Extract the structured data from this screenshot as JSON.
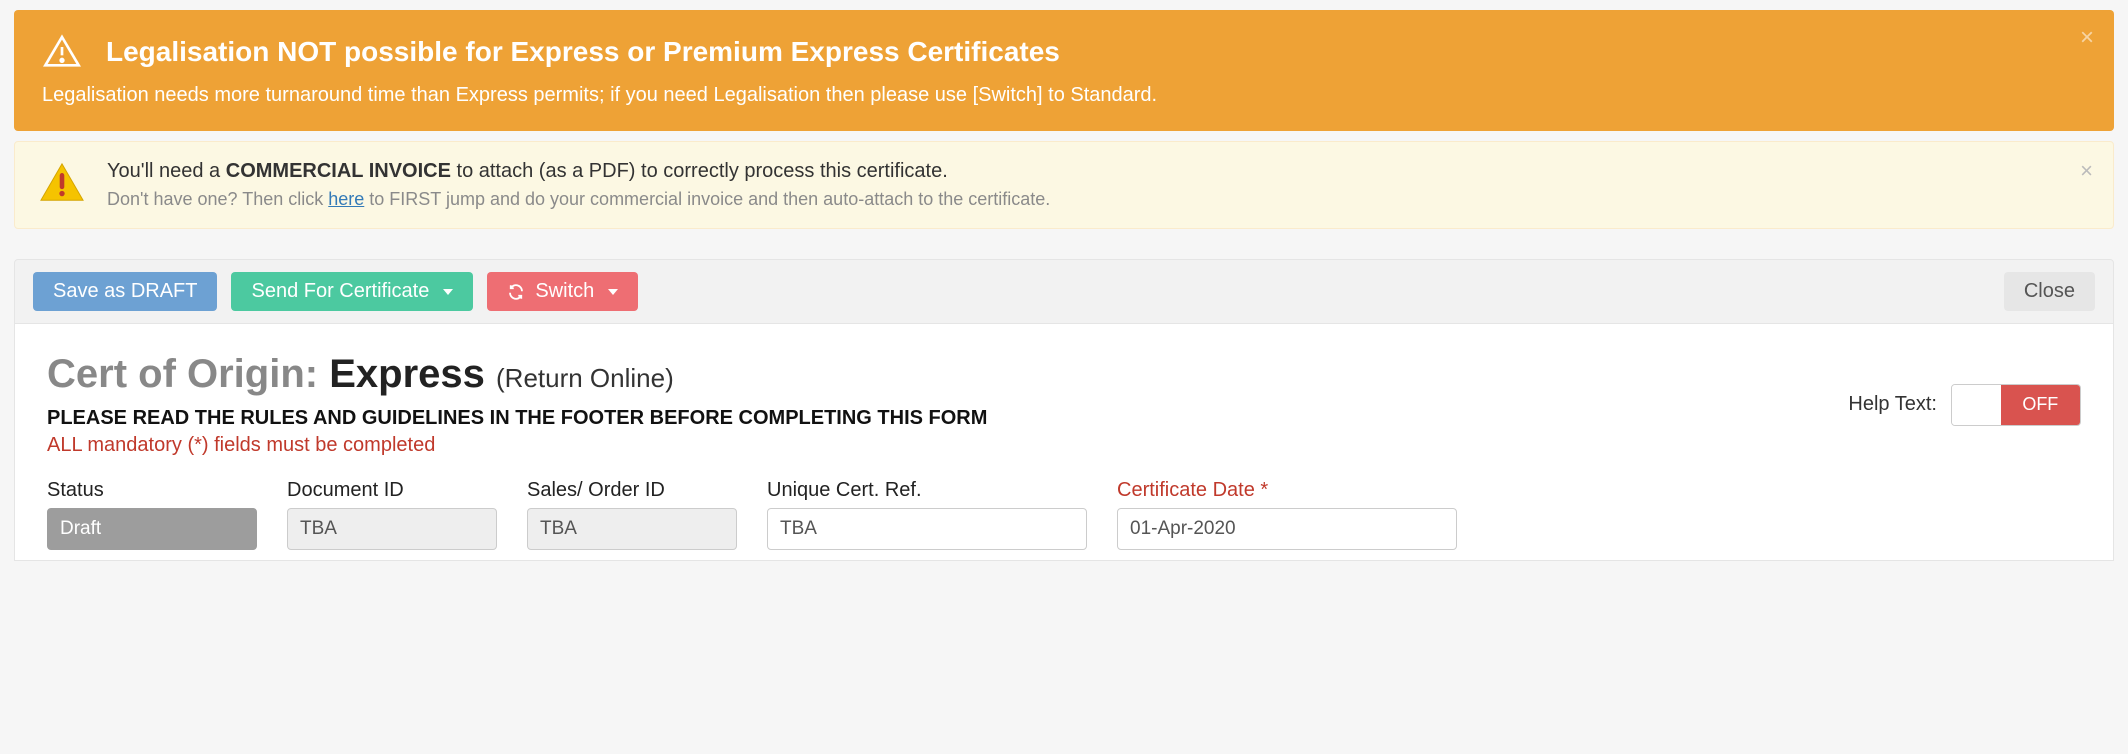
{
  "alerts": {
    "orange": {
      "title": "Legalisation NOT possible for Express or Premium Express Certificates",
      "subtitle": "Legalisation needs more turnaround time than Express permits; if you need Legalisation then please use [Switch] to Standard."
    },
    "yellow": {
      "line1_pre": "You'll need a ",
      "line1_bold": "COMMERCIAL INVOICE",
      "line1_post": " to attach (as a PDF) to correctly process this certificate.",
      "line2_pre": "Don't have one? Then click ",
      "line2_link": "here",
      "line2_post": " to FIRST jump and do your commercial invoice and then auto-attach to the certificate."
    }
  },
  "toolbar": {
    "save": "Save as DRAFT",
    "send": "Send For Certificate",
    "switch": "Switch",
    "close": "Close"
  },
  "heading": {
    "prefix": "Cert of Origin: ",
    "main": "Express",
    "sub": "(Return Online)",
    "rules": "PLEASE READ THE RULES AND GUIDELINES IN THE FOOTER BEFORE COMPLETING THIS FORM",
    "mandatory": "ALL mandatory (*) fields must be completed",
    "help_label": "Help Text:",
    "help_value": "OFF"
  },
  "fields": {
    "status": {
      "label": "Status",
      "value": "Draft"
    },
    "doc_id": {
      "label": "Document ID",
      "value": "TBA"
    },
    "sales_id": {
      "label": "Sales/ Order ID",
      "value": "TBA"
    },
    "cert_ref": {
      "label": "Unique Cert. Ref.",
      "value": "TBA"
    },
    "cert_date": {
      "label": "Certificate Date *",
      "value": "01-Apr-2020"
    }
  }
}
